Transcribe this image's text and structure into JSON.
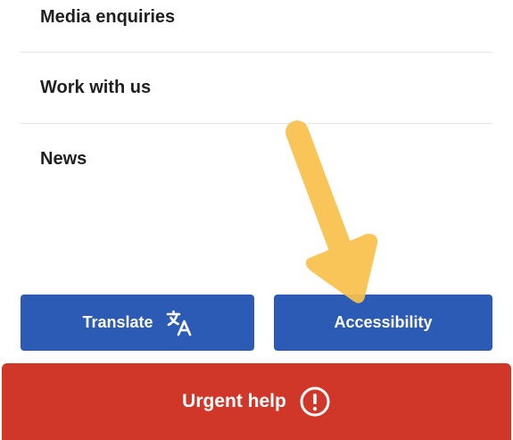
{
  "menu": {
    "items": [
      {
        "label": "Media enquiries"
      },
      {
        "label": "Work with us"
      },
      {
        "label": "News"
      }
    ]
  },
  "buttons": {
    "translate_label": "Translate",
    "accessibility_label": "Accessibility",
    "urgent_label": "Urgent help"
  },
  "icons": {
    "translate": "translate-icon",
    "urgent": "exclamation-circle-icon",
    "annotation": "arrow-icon"
  },
  "colors": {
    "primary_blue": "#2b5bb5",
    "urgent_red": "#d13728",
    "annotation_arrow": "#f9c04a"
  }
}
